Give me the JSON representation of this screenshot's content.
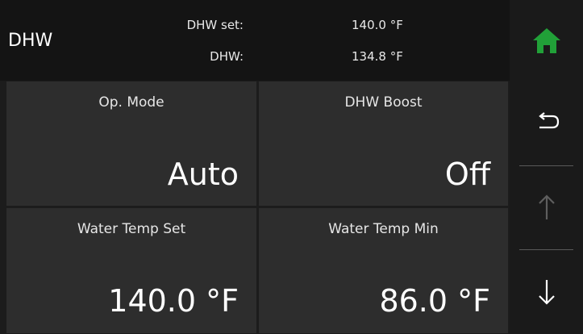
{
  "header": {
    "title": "DHW",
    "dhw_set_label": "DHW set:",
    "dhw_set_value": "140.0 °F",
    "dhw_label": "DHW:",
    "dhw_value": "134.8 °F"
  },
  "tiles": [
    {
      "label": "Op. Mode",
      "value": "Auto"
    },
    {
      "label": "DHW Boost",
      "value": "Off"
    },
    {
      "label": "Water Temp Set",
      "value": "140.0 °F"
    },
    {
      "label": "Water Temp Min",
      "value": "86.0 °F"
    }
  ],
  "sidebar": {
    "home_icon": "home-icon",
    "back_icon": "return-arrow-icon",
    "up_icon": "arrow-up-icon",
    "down_icon": "arrow-down-icon",
    "up_disabled": true
  },
  "colors": {
    "home_icon": "#21a038",
    "tile_bg": "#2d2d2d",
    "header_bg": "#141414",
    "disabled_arrow": "#5e5e5e"
  }
}
